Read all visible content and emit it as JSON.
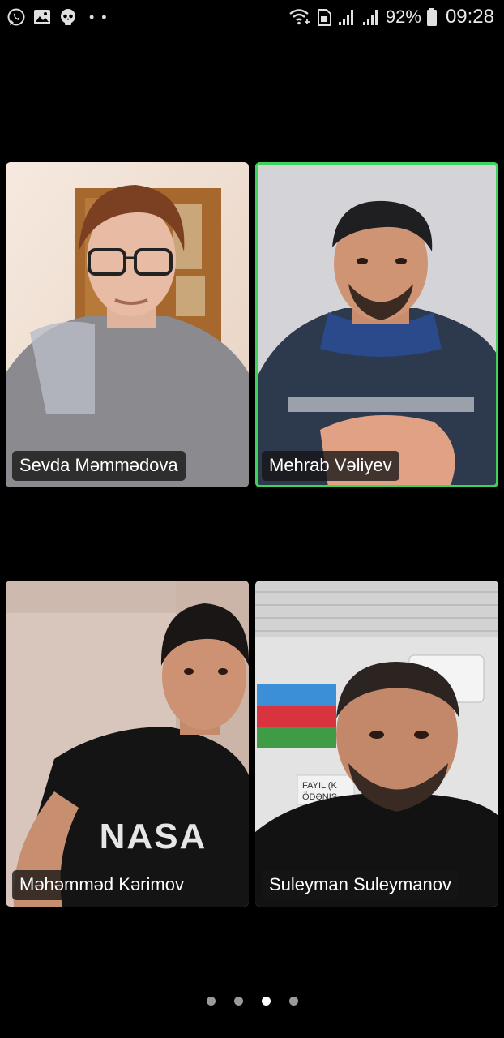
{
  "status_bar": {
    "left_icons": [
      "whatsapp-icon",
      "gallery-icon",
      "skull-icon",
      "more-dots-icon"
    ],
    "battery_percent": "92%",
    "time": "09:28"
  },
  "participants": [
    {
      "name": "Sevda Məmmədova",
      "active_speaker": false
    },
    {
      "name": "Mehrab Vəliyev",
      "active_speaker": true
    },
    {
      "name": "Məhəmməd Kərimov",
      "active_speaker": false
    },
    {
      "name": "Suleyman Suleymanov",
      "active_speaker": false
    }
  ],
  "scene_text": {
    "shirt_text": "NASA",
    "sign_line_1": "FAYIL (K",
    "sign_line_2": "ÖDƏNIŞ"
  },
  "pager": {
    "pages": 4,
    "current_page": 3
  },
  "colors": {
    "active_speaker_border": "#3dd45c",
    "label_background": "#141414"
  }
}
